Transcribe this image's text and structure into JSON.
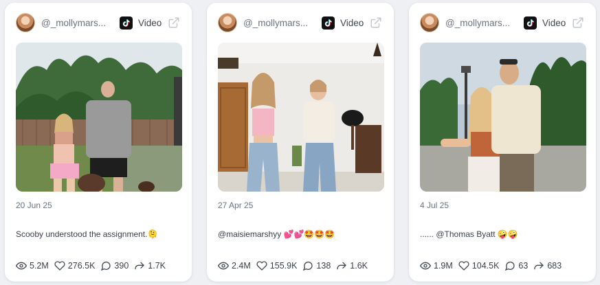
{
  "posts": [
    {
      "handle": "@_mollymars...",
      "platform": "tiktok-icon",
      "type_label": "Video",
      "date": "20 Jun 25",
      "caption": "Scooby understood the assignment.🫠",
      "stats": {
        "views": "5.2M",
        "likes": "276.5K",
        "comments": "390",
        "shares": "1.7K"
      }
    },
    {
      "handle": "@_mollymars...",
      "platform": "tiktok-icon",
      "type_label": "Video",
      "date": "27 Apr 25",
      "caption": "@maisiemarshyy 💕💕🤩🤩🤩",
      "stats": {
        "views": "2.4M",
        "likes": "155.9K",
        "comments": "138",
        "shares": "1.6K"
      }
    },
    {
      "handle": "@_mollymars...",
      "platform": "tiktok-icon",
      "type_label": "Video",
      "date": "4 Jul 25",
      "caption": "...... @Thomas Byatt 🤪🤪",
      "stats": {
        "views": "1.9M",
        "likes": "104.5K",
        "comments": "63",
        "shares": "683"
      }
    }
  ],
  "colors": {
    "background": "#eef0f4",
    "card": "#ffffff",
    "muted_text": "#6b7280",
    "tiktok": "#111111"
  }
}
